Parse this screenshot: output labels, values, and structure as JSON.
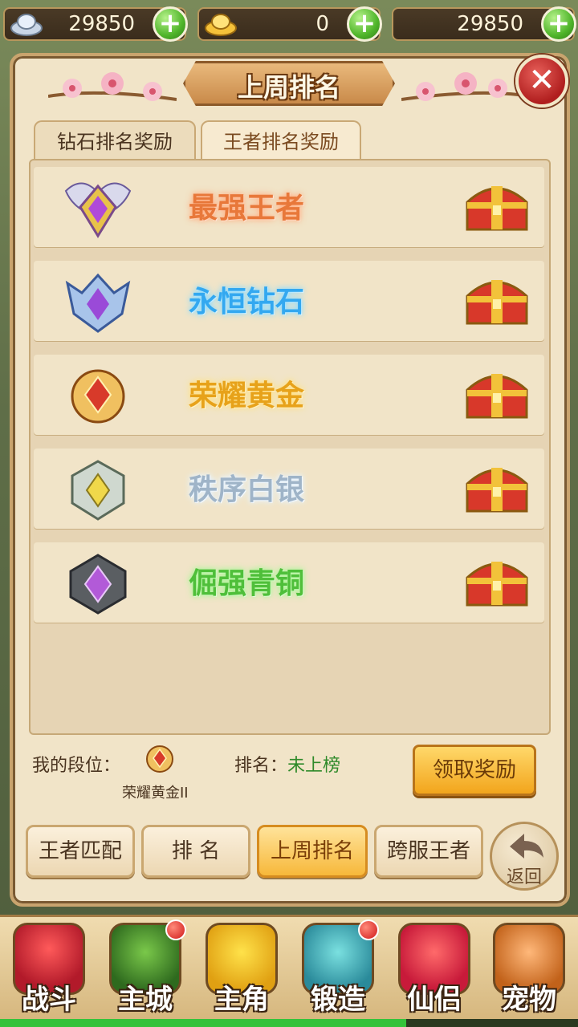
{
  "currency": [
    {
      "icon": "silver-ingot-icon",
      "value": "29850"
    },
    {
      "icon": "gold-ingot-icon",
      "value": "0"
    },
    {
      "icon": "",
      "value": "29850"
    }
  ],
  "panel": {
    "title": "上周排名",
    "tabs": [
      {
        "label": "钻石排名奖励",
        "active": false
      },
      {
        "label": "王者排名奖励",
        "active": true
      }
    ],
    "ranks": [
      {
        "name": "最强王者",
        "color": "#e8783a",
        "glow": "#ffb48a",
        "badge": "king-badge-icon"
      },
      {
        "name": "永恒钻石",
        "color": "#33a8f0",
        "glow": "#8fdcff",
        "badge": "diamond-badge-icon"
      },
      {
        "name": "荣耀黄金",
        "color": "#e7a21a",
        "glow": "#ffe28a",
        "badge": "gold-badge-icon"
      },
      {
        "name": "秩序白银",
        "color": "#9fb4c8",
        "glow": "#e6f3ff",
        "badge": "silver-badge-icon"
      },
      {
        "name": "倔强青铜",
        "color": "#4fbf3a",
        "glow": "#aef59a",
        "badge": "bronze-badge-icon"
      }
    ],
    "my_tier_label": "我的段位：",
    "my_tier_name": "荣耀黄金II",
    "rank_label": "排名：",
    "rank_value": "未上榜",
    "claim_button": "领取奖励"
  },
  "nav": [
    {
      "label": "王者匹配",
      "active": false
    },
    {
      "label": "排 名",
      "active": false
    },
    {
      "label": "上周排名",
      "active": true
    },
    {
      "label": "跨服王者",
      "active": false
    }
  ],
  "back_button": "返回",
  "menu": [
    {
      "label": "战斗",
      "icon": "battle-icon",
      "dot": false
    },
    {
      "label": "主城",
      "icon": "main-city-icon",
      "dot": true
    },
    {
      "label": "主角",
      "icon": "hero-icon",
      "dot": false
    },
    {
      "label": "锻造",
      "icon": "forge-icon",
      "dot": true
    },
    {
      "label": "仙侣",
      "icon": "partner-icon",
      "dot": false
    },
    {
      "label": "宠物",
      "icon": "pet-icon",
      "dot": false
    }
  ]
}
